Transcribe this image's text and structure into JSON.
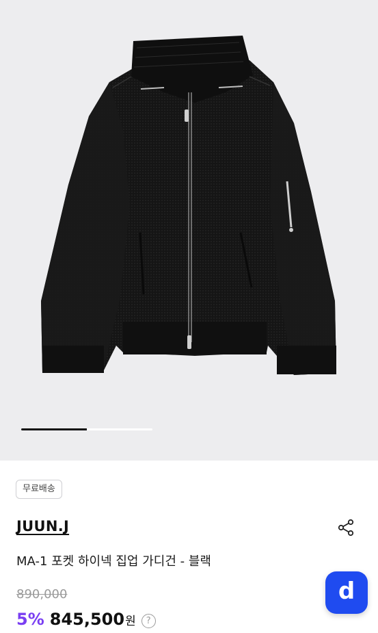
{
  "product": {
    "image_alt": "black knit zip-up cardigan",
    "carousel_progress": 0.5,
    "shipping_badge": "무료배송",
    "brand": "JUUN.J",
    "title": "MA-1 포켓 하이넥 집업 가디건 - 블랙",
    "original_price": "890,000",
    "discount": "5%",
    "price": "845,500",
    "currency": "원",
    "help_symbol": "?"
  },
  "actions": {
    "share_icon": "share-icon",
    "fab_label": "d",
    "fab_color": "#1f4bf0"
  },
  "colors": {
    "discount": "#7a3ff2",
    "hero_bg": "#ededef"
  }
}
